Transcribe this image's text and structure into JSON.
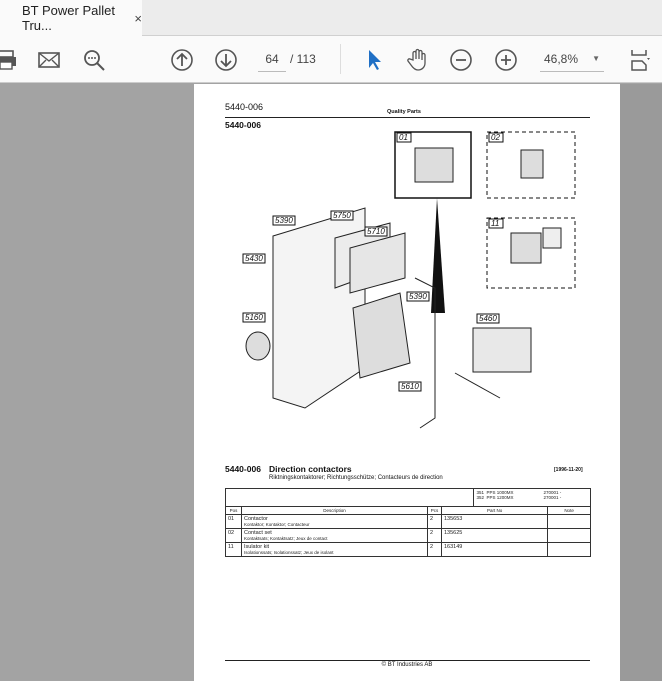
{
  "tab": {
    "title": "BT Power Pallet Tru...",
    "close": "×"
  },
  "toolbar": {
    "page_current": "64",
    "page_total": "/ 113",
    "zoom": "46,8%"
  },
  "document": {
    "header_code": "5440-006",
    "header_center": "Quality Parts",
    "section_code": "5440-006",
    "callouts": [
      "01",
      "02",
      "11",
      "5390",
      "5750",
      "5710",
      "5430",
      "5390",
      "5160",
      "5460",
      "5610"
    ],
    "title_code": "5440-006",
    "title": "Direction contactors",
    "date": "[1996-11-20]",
    "subtitle": "Riktningskontaktorer; Richtungsschütze; Contacteurs de direction",
    "models": [
      {
        "no": "351",
        "name": "PPS 1000MX",
        "serial": "270001 -"
      },
      {
        "no": "352",
        "name": "PPS 1200MX",
        "serial": "270001 -"
      }
    ],
    "columns": [
      "Pos",
      "Description",
      "Pcs",
      "Part No",
      "Note"
    ],
    "rows": [
      {
        "pos": "01",
        "desc": "Contactor",
        "desc_sub": "Kontaktor; Kontaktor; Contacteur",
        "pcs": "2",
        "part": "135653",
        "note": ""
      },
      {
        "pos": "02",
        "desc": "Contact set",
        "desc_sub": "Kontaktsats; Kontaktsatz; Jeux de contact",
        "pcs": "2",
        "part": "135625",
        "note": ""
      },
      {
        "pos": "11",
        "desc": "Isulator kit",
        "desc_sub": "Isolationssats; Isolationssatz; Jeux de isolant",
        "pcs": "2",
        "part": "163149",
        "note": ""
      }
    ],
    "footer": "© BT Industries AB"
  }
}
